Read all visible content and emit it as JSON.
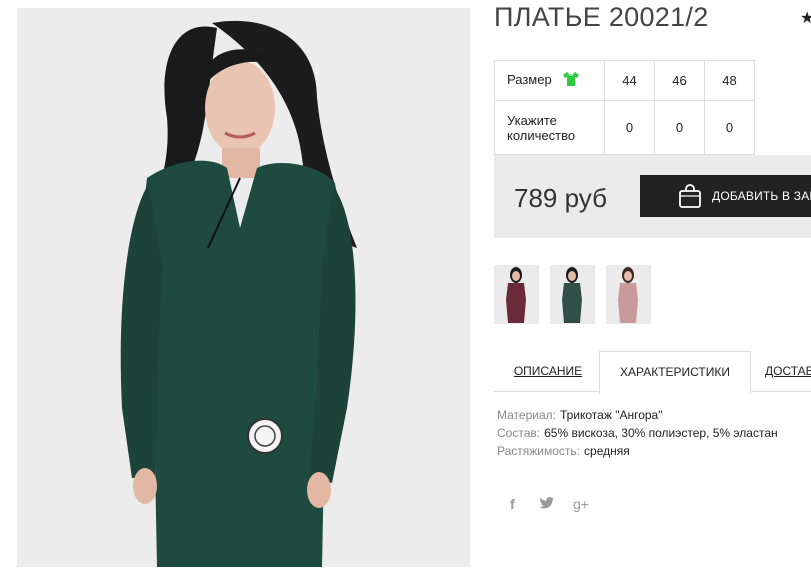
{
  "product": {
    "title": "ПЛАТЬЕ 20021/2"
  },
  "sizes": {
    "size_label": "Размер",
    "qty_label": "Укажите количество",
    "values": [
      "44",
      "46",
      "48"
    ],
    "quantities": [
      "0",
      "0",
      "0"
    ]
  },
  "purchase": {
    "price": "789 руб",
    "add_label": "ДОБАВИТЬ В ЗАКАЗ"
  },
  "tabs": [
    {
      "label": "ОПИСАНИЕ",
      "active": false
    },
    {
      "label": "ХАРАКТЕРИСТИКИ",
      "active": true
    },
    {
      "label": "ДОСТАВКА",
      "active": false
    }
  ],
  "specs": [
    {
      "key": "Материал:",
      "value": "Трикотаж \"Ангора\""
    },
    {
      "key": "Состав:",
      "value": "65% вискоза, 30% полиэстер, 5% эластан"
    },
    {
      "key": "Растяжимость:",
      "value": "средняя"
    }
  ],
  "social": {
    "facebook": "f",
    "google": "g+"
  },
  "colors": {
    "dress_main": "#1f4a3f",
    "thumb_burgundy": "#6b2b3a",
    "thumb_green": "#2f4f46",
    "thumb_pink": "#c99a9a",
    "button_bg": "#222222",
    "size_icon": "#2ecc40"
  }
}
